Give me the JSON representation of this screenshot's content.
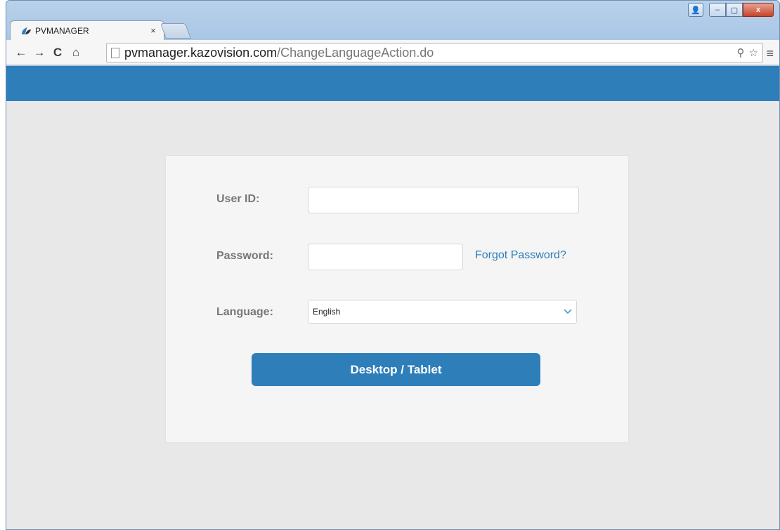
{
  "browser": {
    "tab_title": "PVMANAGER",
    "tab_close": "×",
    "url_host": "pvmanager.kazovision.com",
    "url_path": "/ChangeLanguageAction.do",
    "icons": {
      "back": "←",
      "forward": "→",
      "reload": "C",
      "home": "⌂",
      "key": "⚲",
      "star": "☆",
      "menu": "≡"
    }
  },
  "window_controls": {
    "user": "👤",
    "minimize": "–",
    "maximize": "▢",
    "close": "x"
  },
  "login": {
    "user_id_label": "User ID:",
    "user_id_value": "",
    "password_label": "Password:",
    "password_value": "",
    "forgot_password": "Forgot Password?",
    "language_label": "Language:",
    "language_selected": "English",
    "submit_label": "Desktop / Tablet"
  },
  "colors": {
    "banner": "#2e7eba",
    "button": "#2e7eba",
    "link": "#2e7eba",
    "page_bg": "#e8e8e8",
    "card_bg": "#f5f5f5"
  }
}
